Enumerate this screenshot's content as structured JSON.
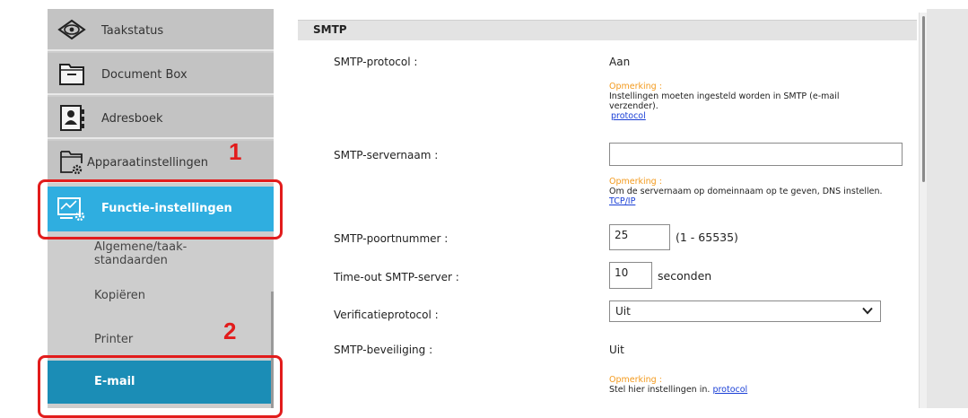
{
  "sidebar": {
    "items": [
      {
        "label": "Taakstatus",
        "icon": "eye-icon"
      },
      {
        "label": "Document Box",
        "icon": "folder-icon"
      },
      {
        "label": "Adresboek",
        "icon": "addressbook-icon"
      },
      {
        "label": "Apparaatinstellingen",
        "icon": "device-settings-icon"
      }
    ],
    "active": {
      "label": "Functie-instellingen",
      "icon": "function-settings-icon"
    },
    "sub_items": [
      "Algemene/taak-standaarden",
      "Kopiëren",
      "Printer"
    ],
    "selected_sub": "E-mail"
  },
  "callouts": {
    "one": "1",
    "two": "2"
  },
  "smtp": {
    "title": "SMTP",
    "protocol": {
      "label": "SMTP-protocol :",
      "value": "Aan"
    },
    "note1": {
      "title": "Opmerking :",
      "text": "Instellingen moeten ingesteld worden in SMTP (e-mail verzender).",
      "link": "protocol"
    },
    "servername": {
      "label": "SMTP-servernaam :",
      "value": ""
    },
    "note2": {
      "title": "Opmerking :",
      "text": "Om de servernaam op domeinnaam op te geven, DNS instellen.",
      "link": "TCP/IP"
    },
    "port": {
      "label": "SMTP-poortnummer :",
      "value": "25",
      "range": "(1 - 65535)"
    },
    "timeout": {
      "label": "Time-out SMTP-server :",
      "value": "10",
      "unit": "seconden"
    },
    "verification": {
      "label": "Verificatieprotocol :",
      "selected": "Uit"
    },
    "security": {
      "label": "SMTP-beveiliging :",
      "value": "Uit"
    },
    "note3": {
      "title": "Opmerking :",
      "text": "Stel hier instellingen in.",
      "link": "protocol"
    }
  },
  "colors": {
    "active_blue": "#2faee0",
    "selected_teal": "#1b8db6",
    "callout_red": "#e21c1c",
    "note_orange": "#f39a1d"
  }
}
